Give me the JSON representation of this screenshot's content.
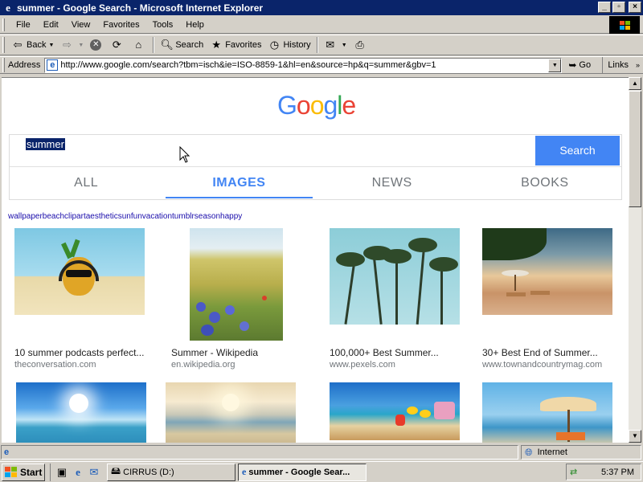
{
  "window": {
    "title": "summer - Google Search - Microsoft Internet Explorer",
    "controls": {
      "minimize": "_",
      "maximize": "▫",
      "close": "×"
    }
  },
  "menu": [
    "File",
    "Edit",
    "View",
    "Favorites",
    "Tools",
    "Help"
  ],
  "toolbar": {
    "back_label": "Back",
    "search_label": "Search",
    "favorites_label": "Favorites",
    "history_label": "History"
  },
  "address": {
    "label": "Address",
    "url": "http://www.google.com/search?tbm=isch&ie=ISO-8859-1&hl=en&source=hp&q=summer&gbv=1",
    "go_label": "Go",
    "links_label": "Links"
  },
  "page": {
    "logo_letters": [
      "G",
      "o",
      "o",
      "g",
      "l",
      "e"
    ],
    "logo_colors": [
      "#4285f4",
      "#ea4335",
      "#fbbc05",
      "#4285f4",
      "#34a853",
      "#ea4335"
    ],
    "search_query": "summer",
    "search_button": "Search",
    "tabs": [
      "ALL",
      "IMAGES",
      "NEWS",
      "BOOKS"
    ],
    "active_tab": "IMAGES",
    "related_searches": "wallpaperbeachclipartaestheticsunfunvacationtumblrseasonhappy",
    "results": [
      {
        "caption": "10 summer podcasts perfect...",
        "source": "theconversation.com"
      },
      {
        "caption": "Summer - Wikipedia",
        "source": "en.wikipedia.org"
      },
      {
        "caption": "100,000+ Best Summer...",
        "source": "www.pexels.com"
      },
      {
        "caption": "30+ Best End of Summer...",
        "source": "www.townandcountrymag.com"
      }
    ]
  },
  "statusbar": {
    "text": "",
    "zone": "Internet"
  },
  "taskbar": {
    "start_label": "Start",
    "tasks": [
      "CIRRUS (D:)",
      "summer - Google Sear..."
    ],
    "clock": "5:37 PM"
  }
}
